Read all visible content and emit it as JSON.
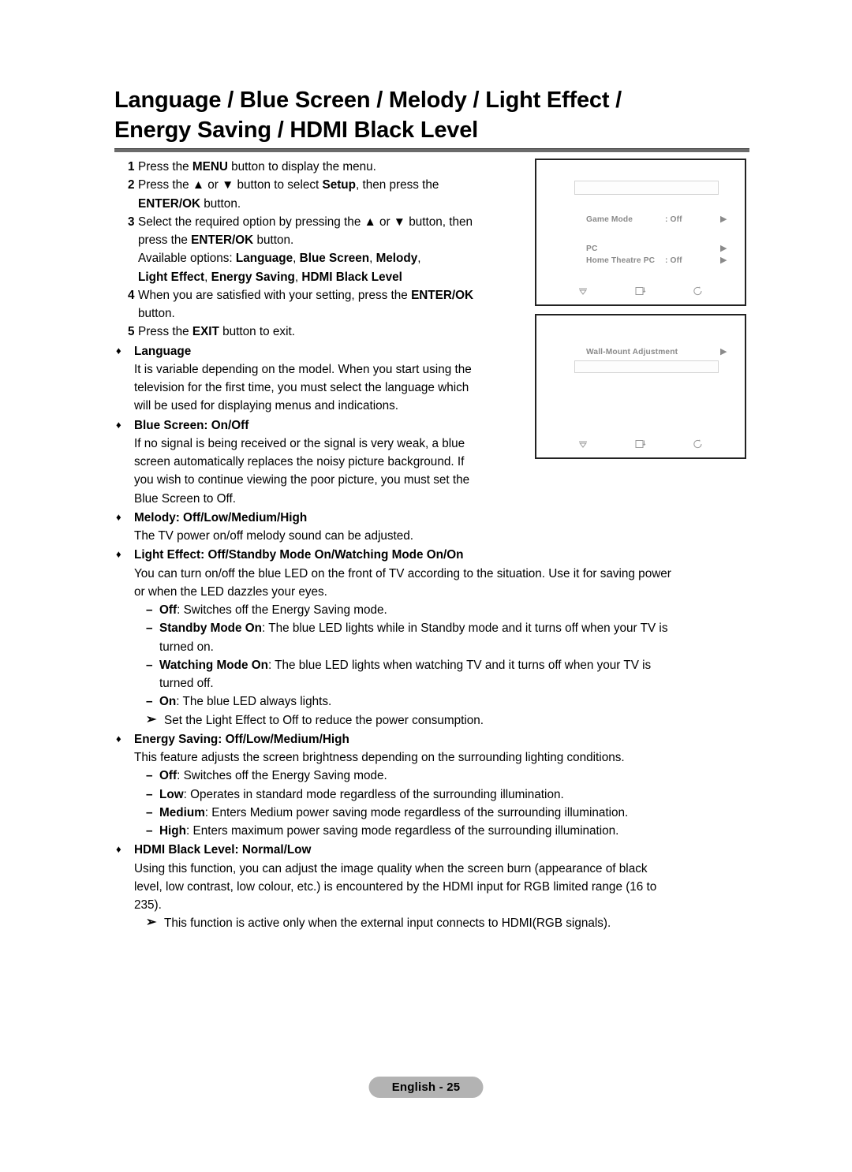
{
  "document": {
    "title_lines": [
      "Language / Blue Screen / Melody / Light Effect /",
      "Energy Saving / HDMI Black Level"
    ],
    "footer_page_label": "English - 25"
  },
  "steps": [
    {
      "number": "1",
      "lines": [
        {
          "parts": [
            {
              "t": "Press the ",
              "b": false
            },
            {
              "t": "MENU",
              "b": true
            },
            {
              "t": " button to display the menu.",
              "b": false
            }
          ]
        }
      ]
    },
    {
      "number": "2",
      "lines": [
        {
          "parts": [
            {
              "t": "Press the ▲ or ▼ button to select ",
              "b": false
            },
            {
              "t": "Setup",
              "b": true
            },
            {
              "t": ", then press the",
              "b": false
            }
          ]
        },
        {
          "parts": [
            {
              "t": "ENTER/OK",
              "b": true
            },
            {
              "t": " button.",
              "b": false
            }
          ]
        }
      ]
    },
    {
      "number": "3",
      "lines": [
        {
          "parts": [
            {
              "t": "Select the required option by pressing the ▲ or ▼ button, then",
              "b": false
            }
          ]
        },
        {
          "parts": [
            {
              "t": "press the ",
              "b": false
            },
            {
              "t": "ENTER/OK",
              "b": true
            },
            {
              "t": " button.",
              "b": false
            }
          ]
        },
        {
          "parts": [
            {
              "t": "Available options: ",
              "b": false
            },
            {
              "t": "Language",
              "b": true
            },
            {
              "t": ", ",
              "b": false
            },
            {
              "t": "Blue Screen",
              "b": true
            },
            {
              "t": ", ",
              "b": false
            },
            {
              "t": "Melody",
              "b": true
            },
            {
              "t": ",",
              "b": false
            }
          ]
        },
        {
          "parts": [
            {
              "t": "Light Effect",
              "b": true
            },
            {
              "t": ", ",
              "b": false
            },
            {
              "t": "Energy Saving",
              "b": true
            },
            {
              "t": ", ",
              "b": false
            },
            {
              "t": "HDMI Black Level",
              "b": true
            }
          ]
        }
      ]
    },
    {
      "number": "4",
      "lines": [
        {
          "parts": [
            {
              "t": "When you are satisfied with your setting, press the ",
              "b": false
            },
            {
              "t": "ENTER/OK",
              "b": true
            }
          ]
        },
        {
          "parts": [
            {
              "t": "button.",
              "b": false
            }
          ]
        }
      ]
    },
    {
      "number": "5",
      "lines": [
        {
          "parts": [
            {
              "t": "Press the ",
              "b": false
            },
            {
              "t": "EXIT",
              "b": true
            },
            {
              "t": " button to exit.",
              "b": false
            }
          ]
        }
      ]
    }
  ],
  "sections": [
    {
      "id": "language",
      "bullet": "♦",
      "title_bold": "Language",
      "title_rest": "",
      "body_lines": [
        "It is variable depending on the model. When you start using the",
        "television for the first time, you must select the language which",
        "will be used for displaying menus and indications."
      ],
      "sub_items": []
    },
    {
      "id": "blue-screen",
      "bullet": "♦",
      "title_bold": "Blue Screen",
      "title_rest": ": On/Off",
      "body_lines": [
        "If no signal is being received or the signal is very weak, a blue",
        "screen automatically replaces the noisy picture background. If",
        "you wish to continue viewing the poor picture, you must set the",
        "Blue Screen to Off."
      ],
      "sub_items": []
    },
    {
      "id": "melody",
      "bullet": "♦",
      "title_bold": "Melody",
      "title_rest": ": Off/Low/Medium/High",
      "body_lines": [
        "The TV power on/off melody sound can be adjusted."
      ],
      "sub_items": []
    },
    {
      "id": "light-effect",
      "bullet": "♦",
      "title_bold": "Light Effect: Off/Standby Mode On/Watching Mode On/On",
      "title_rest": "",
      "body_lines": [
        "You can turn on/off the blue LED on the front of TV according to the situation. Use it for saving power",
        "or when the LED dazzles your eyes."
      ],
      "sub_items": [
        {
          "kind": "dash",
          "mark": "–",
          "bold": "Off",
          "rest": ": Switches off the Energy Saving mode.",
          "cont": ""
        },
        {
          "kind": "dash",
          "mark": "–",
          "bold": "Standby Mode On",
          "rest": ": The blue LED lights while in Standby mode and it turns off when your TV is",
          "cont": "turned on."
        },
        {
          "kind": "dash",
          "mark": "–",
          "bold": "Watching Mode On",
          "rest": ": The blue LED lights when watching TV and it turns off when your TV is",
          "cont": "turned off."
        },
        {
          "kind": "dash",
          "mark": "–",
          "bold": "On",
          "rest": ": The blue LED always lights.",
          "cont": ""
        },
        {
          "kind": "note",
          "mark": "➢",
          "bold": "",
          "rest": "Set the Light Effect to Off to reduce the power consumption.",
          "cont": ""
        }
      ]
    },
    {
      "id": "energy-saving",
      "bullet": "♦",
      "title_bold": "Energy Saving",
      "title_rest": ": Off/Low/Medium/High",
      "body_lines": [
        "This feature adjusts the screen brightness depending on the surrounding lighting conditions."
      ],
      "sub_items": [
        {
          "kind": "dash",
          "mark": "–",
          "bold": "Off",
          "rest": ": Switches off the Energy Saving mode.",
          "cont": ""
        },
        {
          "kind": "dash",
          "mark": "–",
          "bold": "Low",
          "rest": ": Operates in standard mode regardless of the surrounding illumination.",
          "cont": ""
        },
        {
          "kind": "dash",
          "mark": "–",
          "bold": "Medium",
          "rest": ": Enters Medium power saving mode regardless of the surrounding illumination.",
          "cont": ""
        },
        {
          "kind": "dash",
          "mark": "–",
          "bold": "High",
          "rest": ": Enters maximum power saving mode regardless of the surrounding illumination.",
          "cont": ""
        }
      ]
    },
    {
      "id": "hdmi-black-level",
      "bullet": "♦",
      "title_bold": "HDMI Black Level",
      "title_rest": ": Normal/Low",
      "body_lines": [
        "Using this function, you can adjust the image quality when the screen burn (appearance of black",
        "level, low contrast, low colour, etc.) is encountered by the HDMI input for RGB limited range (16 to",
        "235)."
      ],
      "sub_items": [
        {
          "kind": "note",
          "mark": "➢",
          "bold": "",
          "rest": "This function is active only when the external input connects to HDMI(RGB signals).",
          "cont": ""
        }
      ]
    }
  ],
  "osd_setup": {
    "name": "setup-menu-screenshot",
    "rows": [
      {
        "label": "Game Mode",
        "value": ": Off",
        "arrow": "▶"
      },
      {
        "label": "PC",
        "value": "",
        "arrow": "▶"
      },
      {
        "label": "Home Theatre PC",
        "value": ": Off",
        "arrow": "▶"
      }
    ],
    "footer_icons": [
      "move-icon",
      "enter-icon",
      "return-icon"
    ]
  },
  "osd_wall": {
    "name": "wall-mount-menu-screenshot",
    "rows": [
      {
        "label": "Wall-Mount Adjustment",
        "value": "",
        "arrow": "▶"
      }
    ],
    "footer_icons": [
      "move-icon",
      "enter-icon",
      "return-icon"
    ]
  },
  "colors": {
    "rule": "#6b6b6b",
    "osd_text": "#8a8a8a",
    "badge_bg": "#b3b3b3"
  }
}
